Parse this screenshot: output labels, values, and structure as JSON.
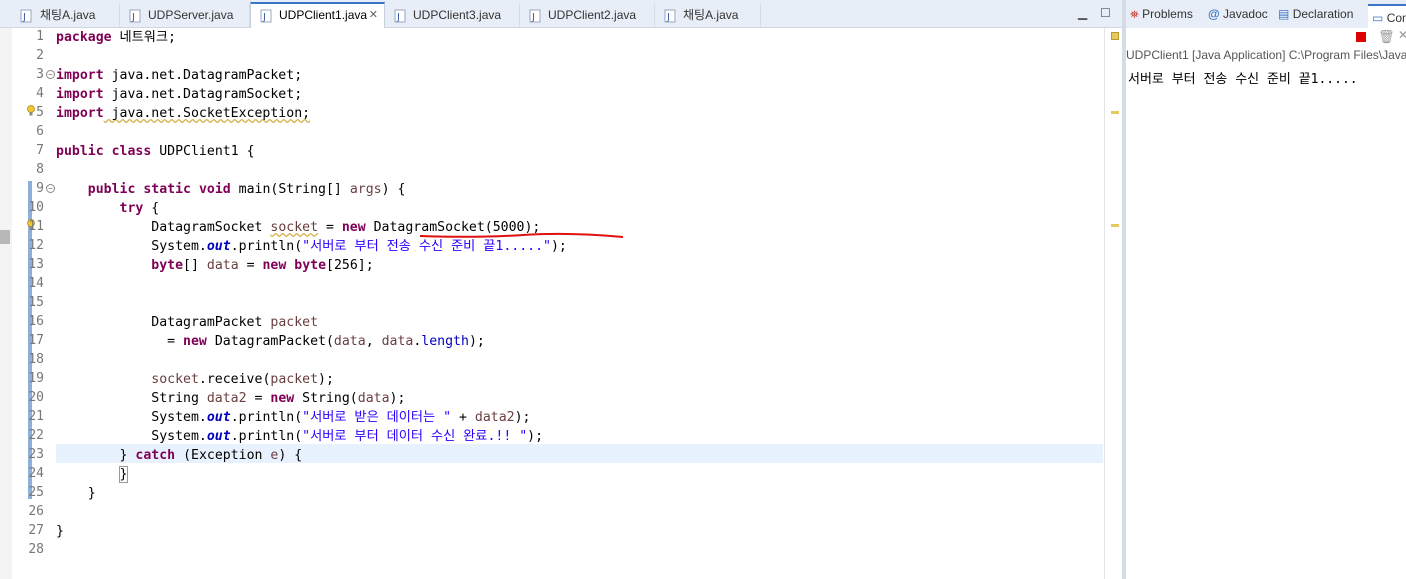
{
  "editor_tabs": [
    {
      "label": "채팅A.java"
    },
    {
      "label": "UDPServer.java"
    },
    {
      "label": "UDPClient1.java",
      "active": true
    },
    {
      "label": "UDPClient3.java"
    },
    {
      "label": "UDPClient2.java"
    },
    {
      "label": "채팅A.java"
    }
  ],
  "code": {
    "lines": [
      {
        "n": "1"
      },
      {
        "n": "2"
      },
      {
        "n": "3"
      },
      {
        "n": "4"
      },
      {
        "n": "5"
      },
      {
        "n": "6"
      },
      {
        "n": "7"
      },
      {
        "n": "8"
      },
      {
        "n": "9"
      },
      {
        "n": "10"
      },
      {
        "n": "11"
      },
      {
        "n": "12"
      },
      {
        "n": "13"
      },
      {
        "n": "14"
      },
      {
        "n": "15"
      },
      {
        "n": "16"
      },
      {
        "n": "17"
      },
      {
        "n": "18"
      },
      {
        "n": "19"
      },
      {
        "n": "20"
      },
      {
        "n": "21"
      },
      {
        "n": "22"
      },
      {
        "n": "23"
      },
      {
        "n": "24"
      },
      {
        "n": "25"
      },
      {
        "n": "26"
      },
      {
        "n": "27"
      },
      {
        "n": "28"
      }
    ],
    "t": {
      "package": "package",
      "pkgname": " 네트워크;",
      "import": "import",
      "imp1": " java.net.DatagramPacket;",
      "imp2": " java.net.DatagramSocket;",
      "imp3": " java.net.SocketException;",
      "public": "public",
      "class": "class",
      "classname": " UDPClient1 {",
      "static": "static",
      "void": "void",
      "mainsig": " main(String[] ",
      "args": "args",
      "mainend": ") {",
      "try": "try",
      "brace": " {",
      "dsock": "DatagramSocket ",
      "socket": "socket",
      "eq": " = ",
      "new": "new",
      "dsockctor": " DatagramSocket(5000);",
      "sysout": "System.",
      "out": "out",
      "println": ".println(",
      "str1": "\"서버로 부터 전송 수신 준비 끝1.....\"",
      "close": ");",
      "byte": "byte",
      "arr": "[] ",
      "data": "data",
      "bytenew": "[256];",
      "dpacket": "DatagramPacket ",
      "packet": "packet",
      "eq2": " = ",
      "dpctor": " DatagramPacket(",
      "comma": ", ",
      "dotlen": ".",
      "length": "length",
      "receive": ".receive(",
      "string": "String ",
      "data2": "data2",
      "strctor": " String(",
      "str2": "\"서버로 받은 데이터는 \"",
      "plus": " + ",
      "str3": "\"서버로 부터 데이터 수신 완료.!! \"",
      "catchclose": "} ",
      "catch": "catch",
      "exc": " (Exception ",
      "e": "e",
      "excend": ") {",
      "rbrace": "}"
    }
  },
  "console": {
    "tabs": [
      {
        "label": "Problems"
      },
      {
        "label": "Javadoc"
      },
      {
        "label": "Declaration"
      },
      {
        "label": "Con"
      }
    ],
    "header": "UDPClient1 [Java Application] C:\\Program Files\\Java",
    "output": "서버로 부터 전송 수신 준비 끝1....."
  },
  "colors": {
    "keyword": "#7f0055",
    "string": "#2a00ff",
    "field": "#0000c0",
    "local_var": "#6a3e3e",
    "current_line": "#e8f2fe"
  }
}
